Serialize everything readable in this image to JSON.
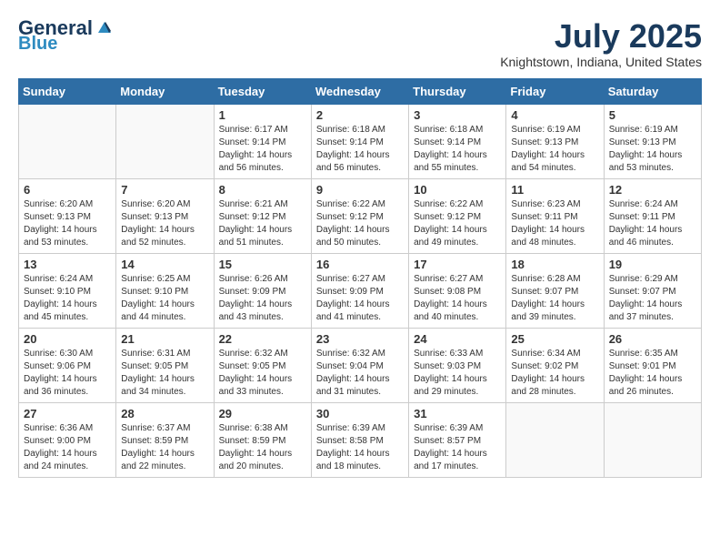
{
  "logo": {
    "general": "General",
    "blue": "Blue"
  },
  "title": {
    "month": "July 2025",
    "location": "Knightstown, Indiana, United States"
  },
  "days_of_week": [
    "Sunday",
    "Monday",
    "Tuesday",
    "Wednesday",
    "Thursday",
    "Friday",
    "Saturday"
  ],
  "weeks": [
    [
      {
        "day": "",
        "info": ""
      },
      {
        "day": "",
        "info": ""
      },
      {
        "day": "1",
        "sunrise": "Sunrise: 6:17 AM",
        "sunset": "Sunset: 9:14 PM",
        "daylight": "Daylight: 14 hours and 56 minutes."
      },
      {
        "day": "2",
        "sunrise": "Sunrise: 6:18 AM",
        "sunset": "Sunset: 9:14 PM",
        "daylight": "Daylight: 14 hours and 56 minutes."
      },
      {
        "day": "3",
        "sunrise": "Sunrise: 6:18 AM",
        "sunset": "Sunset: 9:14 PM",
        "daylight": "Daylight: 14 hours and 55 minutes."
      },
      {
        "day": "4",
        "sunrise": "Sunrise: 6:19 AM",
        "sunset": "Sunset: 9:13 PM",
        "daylight": "Daylight: 14 hours and 54 minutes."
      },
      {
        "day": "5",
        "sunrise": "Sunrise: 6:19 AM",
        "sunset": "Sunset: 9:13 PM",
        "daylight": "Daylight: 14 hours and 53 minutes."
      }
    ],
    [
      {
        "day": "6",
        "sunrise": "Sunrise: 6:20 AM",
        "sunset": "Sunset: 9:13 PM",
        "daylight": "Daylight: 14 hours and 53 minutes."
      },
      {
        "day": "7",
        "sunrise": "Sunrise: 6:20 AM",
        "sunset": "Sunset: 9:13 PM",
        "daylight": "Daylight: 14 hours and 52 minutes."
      },
      {
        "day": "8",
        "sunrise": "Sunrise: 6:21 AM",
        "sunset": "Sunset: 9:12 PM",
        "daylight": "Daylight: 14 hours and 51 minutes."
      },
      {
        "day": "9",
        "sunrise": "Sunrise: 6:22 AM",
        "sunset": "Sunset: 9:12 PM",
        "daylight": "Daylight: 14 hours and 50 minutes."
      },
      {
        "day": "10",
        "sunrise": "Sunrise: 6:22 AM",
        "sunset": "Sunset: 9:12 PM",
        "daylight": "Daylight: 14 hours and 49 minutes."
      },
      {
        "day": "11",
        "sunrise": "Sunrise: 6:23 AM",
        "sunset": "Sunset: 9:11 PM",
        "daylight": "Daylight: 14 hours and 48 minutes."
      },
      {
        "day": "12",
        "sunrise": "Sunrise: 6:24 AM",
        "sunset": "Sunset: 9:11 PM",
        "daylight": "Daylight: 14 hours and 46 minutes."
      }
    ],
    [
      {
        "day": "13",
        "sunrise": "Sunrise: 6:24 AM",
        "sunset": "Sunset: 9:10 PM",
        "daylight": "Daylight: 14 hours and 45 minutes."
      },
      {
        "day": "14",
        "sunrise": "Sunrise: 6:25 AM",
        "sunset": "Sunset: 9:10 PM",
        "daylight": "Daylight: 14 hours and 44 minutes."
      },
      {
        "day": "15",
        "sunrise": "Sunrise: 6:26 AM",
        "sunset": "Sunset: 9:09 PM",
        "daylight": "Daylight: 14 hours and 43 minutes."
      },
      {
        "day": "16",
        "sunrise": "Sunrise: 6:27 AM",
        "sunset": "Sunset: 9:09 PM",
        "daylight": "Daylight: 14 hours and 41 minutes."
      },
      {
        "day": "17",
        "sunrise": "Sunrise: 6:27 AM",
        "sunset": "Sunset: 9:08 PM",
        "daylight": "Daylight: 14 hours and 40 minutes."
      },
      {
        "day": "18",
        "sunrise": "Sunrise: 6:28 AM",
        "sunset": "Sunset: 9:07 PM",
        "daylight": "Daylight: 14 hours and 39 minutes."
      },
      {
        "day": "19",
        "sunrise": "Sunrise: 6:29 AM",
        "sunset": "Sunset: 9:07 PM",
        "daylight": "Daylight: 14 hours and 37 minutes."
      }
    ],
    [
      {
        "day": "20",
        "sunrise": "Sunrise: 6:30 AM",
        "sunset": "Sunset: 9:06 PM",
        "daylight": "Daylight: 14 hours and 36 minutes."
      },
      {
        "day": "21",
        "sunrise": "Sunrise: 6:31 AM",
        "sunset": "Sunset: 9:05 PM",
        "daylight": "Daylight: 14 hours and 34 minutes."
      },
      {
        "day": "22",
        "sunrise": "Sunrise: 6:32 AM",
        "sunset": "Sunset: 9:05 PM",
        "daylight": "Daylight: 14 hours and 33 minutes."
      },
      {
        "day": "23",
        "sunrise": "Sunrise: 6:32 AM",
        "sunset": "Sunset: 9:04 PM",
        "daylight": "Daylight: 14 hours and 31 minutes."
      },
      {
        "day": "24",
        "sunrise": "Sunrise: 6:33 AM",
        "sunset": "Sunset: 9:03 PM",
        "daylight": "Daylight: 14 hours and 29 minutes."
      },
      {
        "day": "25",
        "sunrise": "Sunrise: 6:34 AM",
        "sunset": "Sunset: 9:02 PM",
        "daylight": "Daylight: 14 hours and 28 minutes."
      },
      {
        "day": "26",
        "sunrise": "Sunrise: 6:35 AM",
        "sunset": "Sunset: 9:01 PM",
        "daylight": "Daylight: 14 hours and 26 minutes."
      }
    ],
    [
      {
        "day": "27",
        "sunrise": "Sunrise: 6:36 AM",
        "sunset": "Sunset: 9:00 PM",
        "daylight": "Daylight: 14 hours and 24 minutes."
      },
      {
        "day": "28",
        "sunrise": "Sunrise: 6:37 AM",
        "sunset": "Sunset: 8:59 PM",
        "daylight": "Daylight: 14 hours and 22 minutes."
      },
      {
        "day": "29",
        "sunrise": "Sunrise: 6:38 AM",
        "sunset": "Sunset: 8:59 PM",
        "daylight": "Daylight: 14 hours and 20 minutes."
      },
      {
        "day": "30",
        "sunrise": "Sunrise: 6:39 AM",
        "sunset": "Sunset: 8:58 PM",
        "daylight": "Daylight: 14 hours and 18 minutes."
      },
      {
        "day": "31",
        "sunrise": "Sunrise: 6:39 AM",
        "sunset": "Sunset: 8:57 PM",
        "daylight": "Daylight: 14 hours and 17 minutes."
      },
      {
        "day": "",
        "info": ""
      },
      {
        "day": "",
        "info": ""
      }
    ]
  ]
}
